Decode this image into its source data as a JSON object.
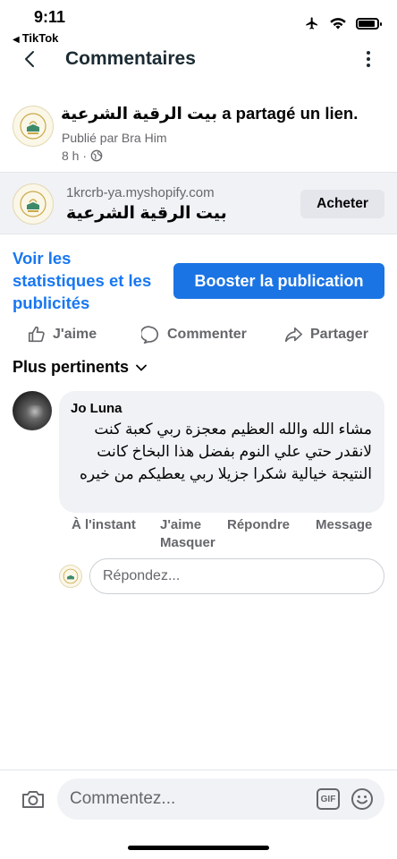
{
  "status_bar": {
    "time": "9:11",
    "back_app": "TikTok",
    "icons": [
      "airplane-icon",
      "wifi-icon",
      "battery-icon"
    ]
  },
  "header": {
    "title": "Commentaires",
    "back_icon": "chevron-left-icon",
    "more_icon": "more-vertical-icon"
  },
  "post": {
    "page_name": "بيت الرقية الشرعية",
    "action_text": "a partagé un lien.",
    "published_by": "Publié par Bra Him",
    "time": "8 h ·",
    "privacy_icon": "globe-icon"
  },
  "link_card": {
    "domain": "1krcrb-ya.myshopify.com",
    "title": "بيت الرقية الشرعية",
    "button_label": "Acheter"
  },
  "promo": {
    "stats_label": "Voir les statistiques et les publicités",
    "boost_label": "Booster la publication"
  },
  "actions": {
    "like_label": "J'aime",
    "comment_label": "Commenter",
    "share_label": "Partager"
  },
  "sort": {
    "label": "Plus pertinents"
  },
  "comment": {
    "author": "Jo Luna",
    "text": "مشاء الله والله العظيم معجزة ربي كعبة كنت لانقدر حتي علي النوم بفضل هذا البخاخ كانت النتيجة خيالية شكرا جزيلا ربي يعطيكم من خيره",
    "time": "À l'instant",
    "like_label": "J'aime",
    "reply_label": "Répondre",
    "message_label": "Message",
    "hide_label": "Masquer"
  },
  "reply": {
    "placeholder": "Répondez..."
  },
  "composer": {
    "placeholder": "Commentez...",
    "gif_label": "GIF"
  },
  "colors": {
    "accent": "#1b74e4",
    "link": "#1877f2",
    "secondary_text": "#65676b",
    "bubble_bg": "#f0f2f5"
  }
}
